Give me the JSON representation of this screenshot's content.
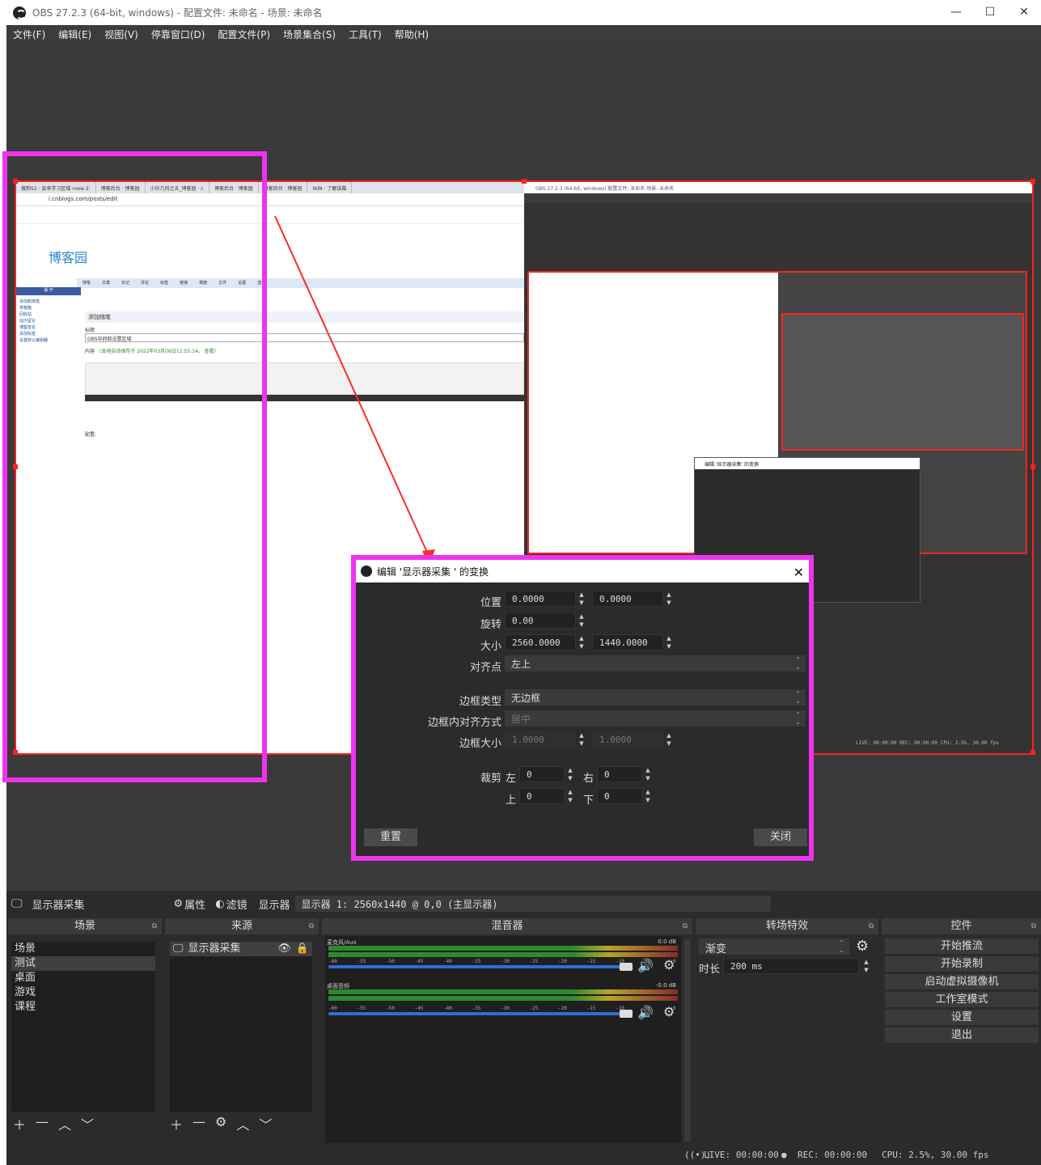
{
  "window": {
    "title": "OBS 27.2.3 (64-bit, windows) - 配置文件: 未命名 - 场景: 未命名",
    "min": "—",
    "max": "☐",
    "close": "✕"
  },
  "menu": [
    "文件(F)",
    "编辑(E)",
    "视图(V)",
    "停靠窗口(D)",
    "配置文件(P)",
    "场景集合(S)",
    "工具(T)",
    "帮助(H)"
  ],
  "capture": {
    "logo": "博客园",
    "url": "i.cnblogs.com/posts/edit",
    "tabs": [
      "搜狗52 · 会来学习区域 rnew 2:",
      "博客后台 · 博客园",
      "小伙几何之五_博客园 · i:",
      "博客后台 · 博客园",
      "博客后台 · 博客园",
      "WIN · 了解该幕"
    ],
    "nav": [
      "随笔",
      "文章",
      "日记",
      "评论",
      "标签",
      "链接",
      "相册",
      "文件",
      "设置",
      "选项"
    ],
    "side_header": "操 作",
    "side_links": [
      "添加新随笔",
      "草稿箱",
      "回收站",
      "站内留言",
      "博客签名",
      "添加标签",
      "设置默认编辑器"
    ],
    "editor_title": "添加随笔",
    "field_title": "标题",
    "title_value": "OBS中抓取设置区域",
    "content_label": "内容",
    "draft_note": "(本地自动保存于 2022年03月06日12:55:14。 查看)",
    "body_text": "配置:",
    "inner_title": "OBS 27.2.3 (64-bit, windows)   配置文件: 未命名   场景: 未命名",
    "inner_dialog": "编辑 '显示器采集' 的变换",
    "inner_status": "LIVE: 00:00:00   REC: 00:00:00   CPU: 2.5%, 30.00 fps"
  },
  "dialog": {
    "title": "编辑 '显示器采集 ' 的变换",
    "position_label": "位置",
    "pos_x": "0.0000",
    "pos_y": "0.0000",
    "rotation_label": "旋转",
    "rotation": "0.00",
    "size_label": "大小",
    "size_w": "2560.0000",
    "size_h": "1440.0000",
    "align_label": "对齐点",
    "align": "左上",
    "bounds_type_label": "边框类型",
    "bounds_type": "无边框",
    "bounds_align_label": "边框内对齐方式",
    "bounds_align": "居中",
    "bounds_size_label": "边框大小",
    "bounds_w": "1.0000",
    "bounds_h": "1.0000",
    "crop_label": "裁剪",
    "crop_left_label": "左",
    "crop_left": "0",
    "crop_right_label": "右",
    "crop_right": "0",
    "crop_top_label": "上",
    "crop_top": "0",
    "crop_bottom_label": "下",
    "crop_bottom": "0",
    "reset": "重置",
    "close": "关闭"
  },
  "source_toolbar": {
    "source": "显示器采集",
    "properties": "属性",
    "filters": "滤镜",
    "display_label": "显示器",
    "display_value": "显示器 1: 2560x1440 @ 0,0 (主显示器)"
  },
  "scenes": {
    "title": "场景",
    "items": [
      "场景",
      "测试",
      "桌面",
      "游戏",
      "课程"
    ],
    "selected": 1
  },
  "sources": {
    "title": "来源",
    "items": [
      "显示器采集"
    ]
  },
  "mixer": {
    "title": "混音器",
    "ch1": "麦克风/Aux",
    "ch1_db": "0.0 dB",
    "ch2": "桌面音频",
    "ch2_db": "-0.0 dB",
    "ticks": [
      "-60",
      "-55",
      "-50",
      "-45",
      "-40",
      "-35",
      "-30",
      "-25",
      "-20",
      "-15",
      "-10",
      "-5",
      "0"
    ]
  },
  "transitions": {
    "title": "转场特效",
    "value": "渐变",
    "duration_label": "时长",
    "duration": "200 ms"
  },
  "controls": {
    "title": "控件",
    "buttons": [
      "开始推流",
      "开始录制",
      "启动虚拟摄像机",
      "工作室模式",
      "设置",
      "退出"
    ]
  },
  "status": {
    "live": "LIVE: 00:00:00",
    "rec": "REC: 00:00:00",
    "cpu": "CPU: 2.5%, 30.00 fps"
  }
}
